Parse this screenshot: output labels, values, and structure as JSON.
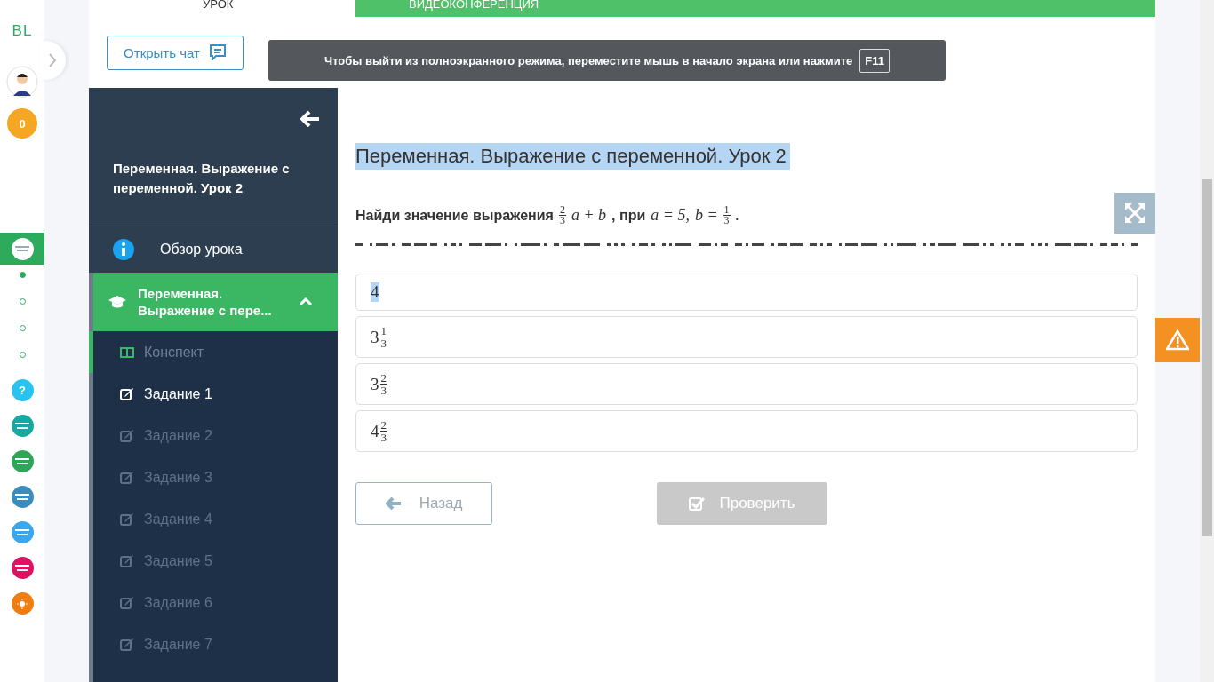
{
  "top_tabs": [
    {
      "label": "УРОК",
      "selected": false
    },
    {
      "label": "ВИДЕОКОНФЕРЕНЦИЯ",
      "selected": true
    }
  ],
  "rail": {
    "logo": "BL",
    "coins": "0",
    "apps": [
      {
        "kind": "mentor",
        "color": "#ffffff",
        "selected": true
      },
      {
        "kind": "help",
        "label": "?",
        "color": "#29c3f2",
        "selected": false
      },
      {
        "kind": "app",
        "color": "#17a99f",
        "selected": false
      },
      {
        "kind": "app",
        "color": "#2ea65a",
        "selected": false
      },
      {
        "kind": "app",
        "color": "#3a8cbf",
        "selected": false
      },
      {
        "kind": "app",
        "color": "#38a7ee",
        "selected": false
      },
      {
        "kind": "app",
        "color": "#de1260",
        "selected": false
      },
      {
        "kind": "sun",
        "color": "#f07d12",
        "selected": false
      }
    ],
    "steps": [
      {
        "selected": true
      },
      {
        "selected": false
      },
      {
        "selected": false
      },
      {
        "selected": false
      }
    ]
  },
  "chat_button": "Открыть чат",
  "fullscreen_notice": {
    "text": "Чтобы выйти из полноэкранного режима, переместите мышь в начало экрана или нажмите",
    "key": "F11"
  },
  "sidebar": {
    "title": "Переменная. Выражение с переменной. Урок 2",
    "overview": "Обзор урока",
    "section": {
      "label": "Переменная. Выражение с пере...",
      "expanded": true,
      "children": [
        {
          "kind": "notes",
          "label": "Конспект",
          "selected": false,
          "visited": true
        },
        {
          "kind": "task",
          "label": "Задание 1",
          "selected": true,
          "visited": false
        },
        {
          "kind": "task",
          "label": "Задание 2",
          "selected": false,
          "visited": false
        },
        {
          "kind": "task",
          "label": "Задание 3",
          "selected": false,
          "visited": false
        },
        {
          "kind": "task",
          "label": "Задание 4",
          "selected": false,
          "visited": false
        },
        {
          "kind": "task",
          "label": "Задание 5",
          "selected": false,
          "visited": false
        },
        {
          "kind": "task",
          "label": "Задание 6",
          "selected": false,
          "visited": false
        },
        {
          "kind": "task",
          "label": "Задание 7",
          "selected": false,
          "visited": false
        }
      ]
    }
  },
  "content": {
    "title": "Переменная. Выражение с переменной. Урок 2",
    "title_highlighted": true,
    "question": [
      {
        "kind": "text",
        "text": "Найди значение выражения"
      },
      {
        "kind": "frac",
        "num": "2",
        "den": "3"
      },
      {
        "kind": "math",
        "text": "a + b"
      },
      {
        "kind": "text",
        "text": ", при"
      },
      {
        "kind": "math",
        "text": "a = 5,"
      },
      {
        "kind": "math",
        "text": "b ="
      },
      {
        "kind": "frac",
        "num": "1",
        "den": "3"
      },
      {
        "kind": "math",
        "text": "."
      }
    ],
    "options": [
      {
        "whole": "4",
        "highlighted": true
      },
      {
        "whole": "3",
        "num": "1",
        "den": "3",
        "highlighted": false
      },
      {
        "whole": "3",
        "num": "2",
        "den": "3",
        "highlighted": false
      },
      {
        "whole": "4",
        "num": "2",
        "den": "3",
        "highlighted": false
      }
    ],
    "back_button": "Назад",
    "check_button": {
      "label": "Проверить",
      "disabled": true
    }
  }
}
